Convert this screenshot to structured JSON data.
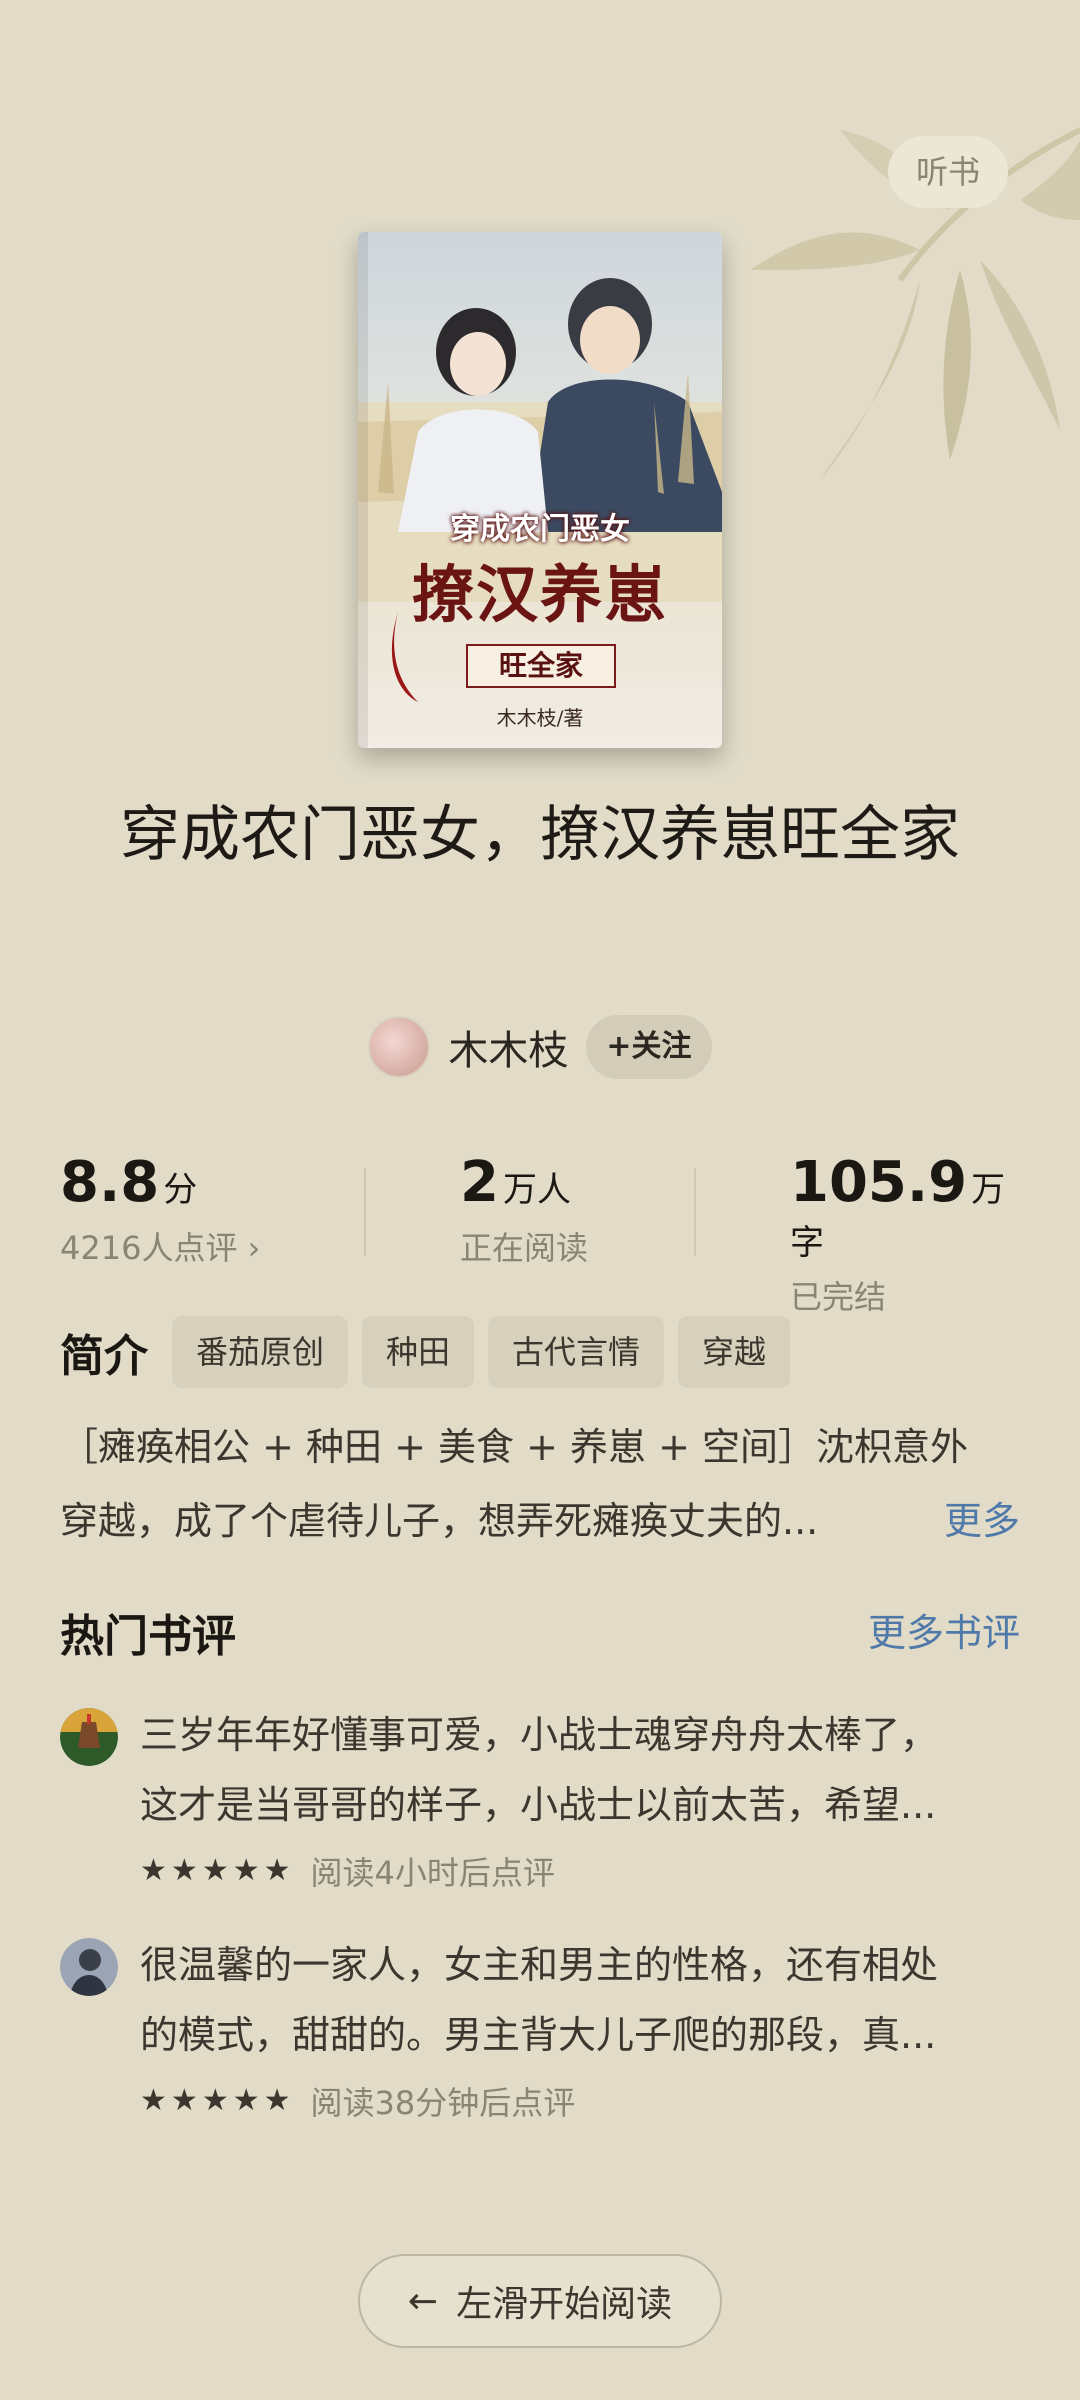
{
  "header": {
    "listen_label": "听书"
  },
  "cover": {
    "title_top": "穿成农门恶女",
    "title_main": "撩汉养崽",
    "title_sub": "旺全家",
    "author_line": "木木枝/著"
  },
  "book": {
    "title": "穿成农门恶女，撩汉养崽旺全家"
  },
  "author": {
    "name": "木木枝",
    "follow_label": "+关注"
  },
  "stats": {
    "rating": {
      "value": "8.8",
      "unit": "分",
      "sub": "4216人点评 ›"
    },
    "readers": {
      "value": "2",
      "unit": "万人",
      "sub": "正在阅读"
    },
    "words": {
      "value": "105.9",
      "unit": "万字",
      "sub": "已完结"
    }
  },
  "intro": {
    "label": "简介",
    "tags": [
      "番茄原创",
      "种田",
      "古代言情",
      "穿越"
    ],
    "line1": "［瘫痪相公 + 种田 + 美食 + 养崽 + 空间］沈枳意外",
    "line2": "穿越，成了个虐待儿子，想弄死瘫痪丈夫的...",
    "more_label": "更多"
  },
  "reviews": {
    "title": "热门书评",
    "more_label": "更多书评",
    "items": [
      {
        "line1": "三岁年年好懂事可爱，小战士魂穿舟舟太棒了，",
        "line2": "这才是当哥哥的样子，小战士以前太苦，希望...",
        "stars": 5,
        "note": "阅读4小时后点评"
      },
      {
        "line1": "很温馨的一家人，女主和男主的性格，还有相处",
        "line2": "的模式，甜甜的。男主背大儿子爬的那段，真...",
        "stars": 5,
        "note": "阅读38分钟后点评"
      }
    ]
  },
  "footer": {
    "start_label": "左滑开始阅读"
  },
  "colors": {
    "background": "#e1dbc8",
    "accent_link": "#4f79a8",
    "text_primary": "#1b1814",
    "text_muted": "#8a8474"
  }
}
